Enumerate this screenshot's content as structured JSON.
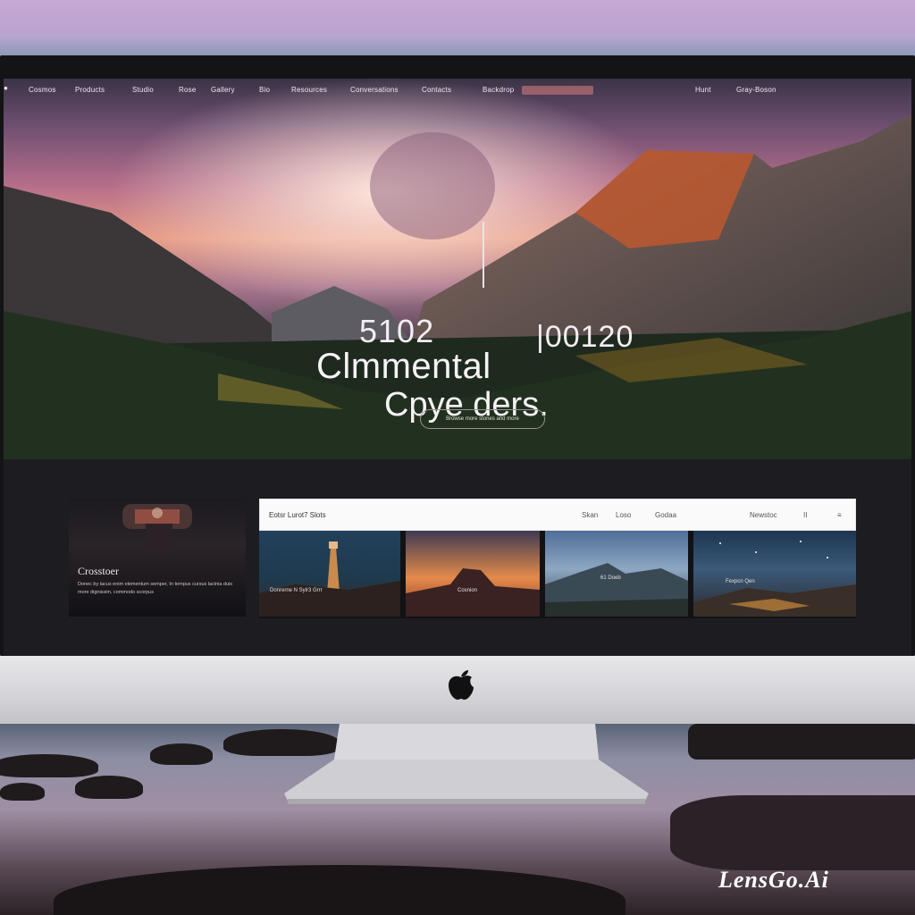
{
  "nav": {
    "items": [
      "Cosmos",
      "Products",
      "Studio",
      "Rose",
      "Gallery",
      "Bio",
      "Resources",
      "Conversations",
      "Contacts",
      "Backdrop"
    ],
    "right_items": [
      "Hunt",
      "Gray-Boson"
    ]
  },
  "hero": {
    "number_left": "5102",
    "number_right": "|00120",
    "title": "Clmmental",
    "subtitle": "Cpye ders.",
    "button": "Browse more stories and more"
  },
  "card": {
    "title": "Crosstoer",
    "description": "Donec by lacus enim elementum semper, In tempus cursus lacinia duis more dignissim, commodo scorpus"
  },
  "gallery": {
    "brand": "Eotsr Lurot7 Slots",
    "controls": [
      "Skan",
      "Loso",
      "Godaa"
    ],
    "right": [
      "Newstoc",
      "II",
      "≡"
    ],
    "captions": [
      "Donrerne N Sylr3 Grrr",
      "Cosnion",
      "61 Doeb",
      "Fexpcn Qen"
    ]
  },
  "watermark": "LensGo.Ai"
}
